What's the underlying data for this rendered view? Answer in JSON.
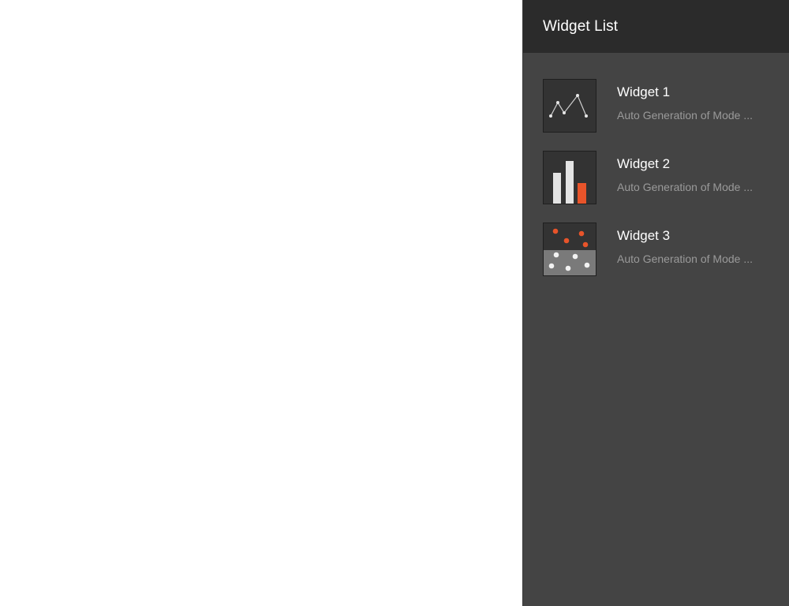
{
  "panel": {
    "title": "Widget List"
  },
  "widgets": [
    {
      "name": "Widget 1",
      "description": "Auto Generation of Mode ...",
      "icon": "line-chart-icon"
    },
    {
      "name": "Widget 2",
      "description": "Auto Generation of Mode ...",
      "icon": "bar-chart-icon"
    },
    {
      "name": "Widget 3",
      "description": "Auto Generation of Mode ...",
      "icon": "scatter-chart-icon"
    }
  ],
  "colors": {
    "header_bg": "#2b2b2b",
    "panel_bg": "#444444",
    "accent": "#e8542a",
    "thumb_bg": "#333333",
    "text_primary": "#ffffff",
    "text_secondary": "#9a9a9a"
  }
}
